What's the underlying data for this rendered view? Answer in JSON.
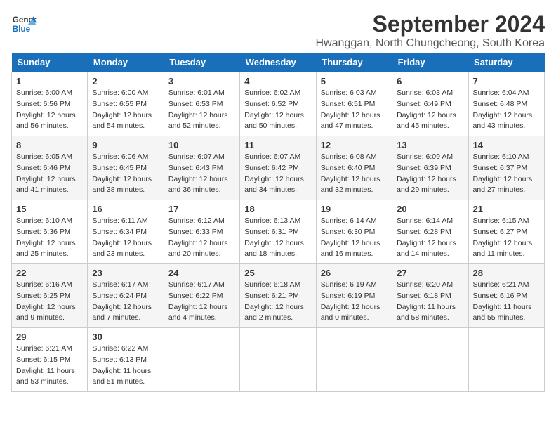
{
  "header": {
    "logo_line1": "General",
    "logo_line2": "Blue",
    "title": "September 2024",
    "location": "Hwanggan, North Chungcheong, South Korea"
  },
  "weekdays": [
    "Sunday",
    "Monday",
    "Tuesday",
    "Wednesday",
    "Thursday",
    "Friday",
    "Saturday"
  ],
  "weeks": [
    [
      {
        "day": "1",
        "sunrise": "6:00 AM",
        "sunset": "6:56 PM",
        "daylight": "12 hours and 56 minutes."
      },
      {
        "day": "2",
        "sunrise": "6:00 AM",
        "sunset": "6:55 PM",
        "daylight": "12 hours and 54 minutes."
      },
      {
        "day": "3",
        "sunrise": "6:01 AM",
        "sunset": "6:53 PM",
        "daylight": "12 hours and 52 minutes."
      },
      {
        "day": "4",
        "sunrise": "6:02 AM",
        "sunset": "6:52 PM",
        "daylight": "12 hours and 50 minutes."
      },
      {
        "day": "5",
        "sunrise": "6:03 AM",
        "sunset": "6:51 PM",
        "daylight": "12 hours and 47 minutes."
      },
      {
        "day": "6",
        "sunrise": "6:03 AM",
        "sunset": "6:49 PM",
        "daylight": "12 hours and 45 minutes."
      },
      {
        "day": "7",
        "sunrise": "6:04 AM",
        "sunset": "6:48 PM",
        "daylight": "12 hours and 43 minutes."
      }
    ],
    [
      {
        "day": "8",
        "sunrise": "6:05 AM",
        "sunset": "6:46 PM",
        "daylight": "12 hours and 41 minutes."
      },
      {
        "day": "9",
        "sunrise": "6:06 AM",
        "sunset": "6:45 PM",
        "daylight": "12 hours and 38 minutes."
      },
      {
        "day": "10",
        "sunrise": "6:07 AM",
        "sunset": "6:43 PM",
        "daylight": "12 hours and 36 minutes."
      },
      {
        "day": "11",
        "sunrise": "6:07 AM",
        "sunset": "6:42 PM",
        "daylight": "12 hours and 34 minutes."
      },
      {
        "day": "12",
        "sunrise": "6:08 AM",
        "sunset": "6:40 PM",
        "daylight": "12 hours and 32 minutes."
      },
      {
        "day": "13",
        "sunrise": "6:09 AM",
        "sunset": "6:39 PM",
        "daylight": "12 hours and 29 minutes."
      },
      {
        "day": "14",
        "sunrise": "6:10 AM",
        "sunset": "6:37 PM",
        "daylight": "12 hours and 27 minutes."
      }
    ],
    [
      {
        "day": "15",
        "sunrise": "6:10 AM",
        "sunset": "6:36 PM",
        "daylight": "12 hours and 25 minutes."
      },
      {
        "day": "16",
        "sunrise": "6:11 AM",
        "sunset": "6:34 PM",
        "daylight": "12 hours and 23 minutes."
      },
      {
        "day": "17",
        "sunrise": "6:12 AM",
        "sunset": "6:33 PM",
        "daylight": "12 hours and 20 minutes."
      },
      {
        "day": "18",
        "sunrise": "6:13 AM",
        "sunset": "6:31 PM",
        "daylight": "12 hours and 18 minutes."
      },
      {
        "day": "19",
        "sunrise": "6:14 AM",
        "sunset": "6:30 PM",
        "daylight": "12 hours and 16 minutes."
      },
      {
        "day": "20",
        "sunrise": "6:14 AM",
        "sunset": "6:28 PM",
        "daylight": "12 hours and 14 minutes."
      },
      {
        "day": "21",
        "sunrise": "6:15 AM",
        "sunset": "6:27 PM",
        "daylight": "12 hours and 11 minutes."
      }
    ],
    [
      {
        "day": "22",
        "sunrise": "6:16 AM",
        "sunset": "6:25 PM",
        "daylight": "12 hours and 9 minutes."
      },
      {
        "day": "23",
        "sunrise": "6:17 AM",
        "sunset": "6:24 PM",
        "daylight": "12 hours and 7 minutes."
      },
      {
        "day": "24",
        "sunrise": "6:17 AM",
        "sunset": "6:22 PM",
        "daylight": "12 hours and 4 minutes."
      },
      {
        "day": "25",
        "sunrise": "6:18 AM",
        "sunset": "6:21 PM",
        "daylight": "12 hours and 2 minutes."
      },
      {
        "day": "26",
        "sunrise": "6:19 AM",
        "sunset": "6:19 PM",
        "daylight": "12 hours and 0 minutes."
      },
      {
        "day": "27",
        "sunrise": "6:20 AM",
        "sunset": "6:18 PM",
        "daylight": "11 hours and 58 minutes."
      },
      {
        "day": "28",
        "sunrise": "6:21 AM",
        "sunset": "6:16 PM",
        "daylight": "11 hours and 55 minutes."
      }
    ],
    [
      {
        "day": "29",
        "sunrise": "6:21 AM",
        "sunset": "6:15 PM",
        "daylight": "11 hours and 53 minutes."
      },
      {
        "day": "30",
        "sunrise": "6:22 AM",
        "sunset": "6:13 PM",
        "daylight": "11 hours and 51 minutes."
      },
      null,
      null,
      null,
      null,
      null
    ]
  ]
}
